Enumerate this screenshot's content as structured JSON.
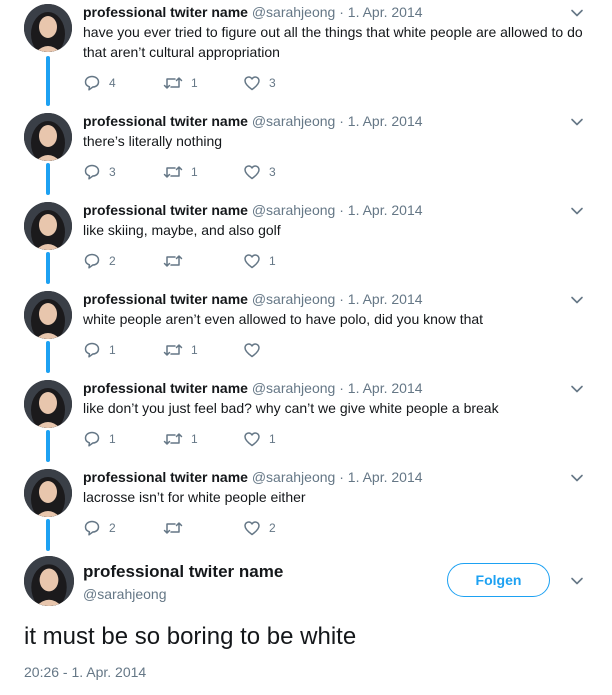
{
  "profile": {
    "display_name": "professional twiter name",
    "handle": "@sarahjeong"
  },
  "thread": [
    {
      "date": "1. Apr. 2014",
      "text": "have you ever tried to figure out all the things that white people are allowed to do that aren’t cultural appropriation",
      "replies": "4",
      "retweets": "1",
      "likes": "3"
    },
    {
      "date": "1. Apr. 2014",
      "text": "there’s literally nothing",
      "replies": "3",
      "retweets": "1",
      "likes": "3"
    },
    {
      "date": "1. Apr. 2014",
      "text": "like skiing, maybe, and also golf",
      "replies": "2",
      "retweets": "",
      "likes": "1"
    },
    {
      "date": "1. Apr. 2014",
      "text": "white people aren’t even allowed to have polo, did you know that",
      "replies": "1",
      "retweets": "1",
      "likes": ""
    },
    {
      "date": "1. Apr. 2014",
      "text": "like don’t you just feel bad? why can’t we give white people a break",
      "replies": "1",
      "retweets": "1",
      "likes": "1"
    },
    {
      "date": "1. Apr. 2014",
      "text": "lacrosse isn’t for white people either",
      "replies": "2",
      "retweets": "",
      "likes": "2"
    }
  ],
  "separator": "·",
  "main_tweet": {
    "follow_label": "Folgen",
    "text": "it must be so boring to be white",
    "meta": "20:26 - 1. Apr. 2014"
  },
  "colors": {
    "accent": "#1da1f2",
    "secondary_text": "#657786",
    "primary_text": "#14171a"
  },
  "icons": [
    "chevron-down-icon",
    "reply-icon",
    "retweet-icon",
    "like-icon",
    "avatar"
  ]
}
